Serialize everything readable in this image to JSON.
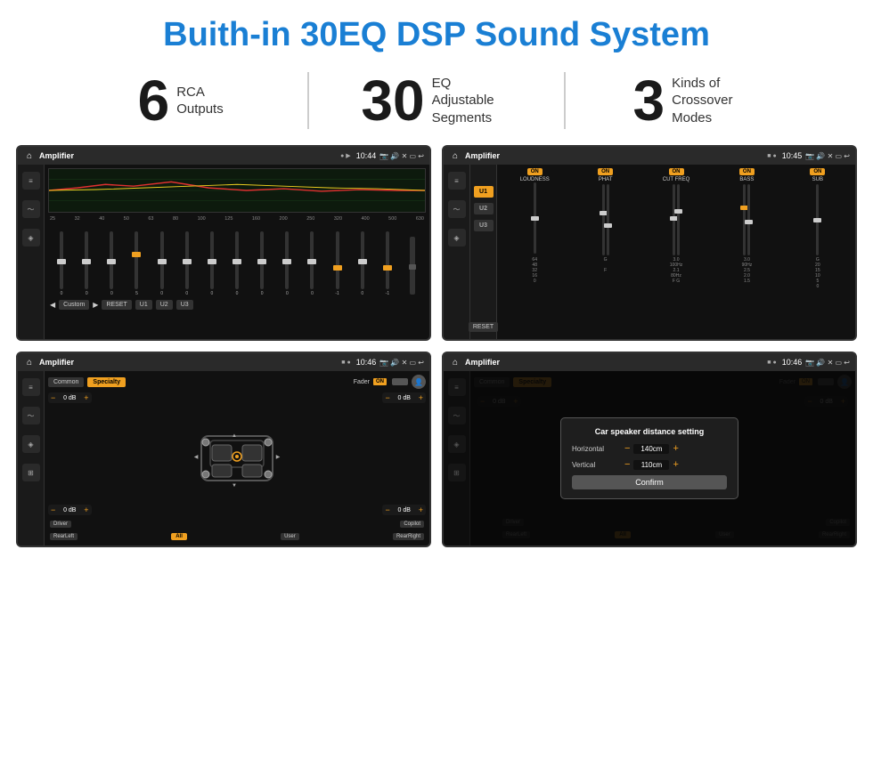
{
  "header": {
    "title": "Buith-in 30EQ DSP Sound System"
  },
  "stats": [
    {
      "number": "6",
      "label_line1": "RCA",
      "label_line2": "Outputs"
    },
    {
      "number": "30",
      "label_line1": "EQ Adjustable",
      "label_line2": "Segments"
    },
    {
      "number": "3",
      "label_line1": "Kinds of",
      "label_line2": "Crossover Modes"
    }
  ],
  "screens": [
    {
      "id": "screen1",
      "status_bar": {
        "title": "Amplifier",
        "time": "10:44"
      },
      "eq": {
        "freq_labels": [
          "25",
          "32",
          "40",
          "50",
          "63",
          "80",
          "100",
          "125",
          "160",
          "200",
          "250",
          "320",
          "400",
          "500",
          "630"
        ],
        "slider_values": [
          "0",
          "0",
          "0",
          "5",
          "0",
          "0",
          "0",
          "0",
          "0",
          "0",
          "0",
          "-1",
          "0",
          "-1",
          ""
        ],
        "presets": [
          "Custom",
          "RESET",
          "U1",
          "U2",
          "U3"
        ]
      }
    },
    {
      "id": "screen2",
      "status_bar": {
        "title": "Amplifier",
        "time": "10:45"
      },
      "u_buttons": [
        "U1",
        "U2",
        "U3"
      ],
      "channels": [
        {
          "name": "LOUDNESS",
          "toggle": "ON"
        },
        {
          "name": "PHAT",
          "toggle": "ON"
        },
        {
          "name": "CUT FREQ",
          "toggle": "ON"
        },
        {
          "name": "BASS",
          "toggle": "ON"
        },
        {
          "name": "SUB",
          "toggle": "ON"
        }
      ],
      "reset_label": "RESET"
    },
    {
      "id": "screen3",
      "status_bar": {
        "title": "Amplifier",
        "time": "10:46"
      },
      "tabs": [
        "Common",
        "Specialty"
      ],
      "fader": {
        "label": "Fader",
        "state": "ON"
      },
      "vol_controls": [
        {
          "label": "0 dB"
        },
        {
          "label": "0 dB"
        },
        {
          "label": "0 dB"
        },
        {
          "label": "0 dB"
        }
      ],
      "seat_labels": [
        "Driver",
        "Copilot",
        "RearLeft",
        "All",
        "User",
        "RearRight"
      ]
    },
    {
      "id": "screen4",
      "status_bar": {
        "title": "Amplifier",
        "time": "10:46"
      },
      "tabs": [
        "Common",
        "Specialty"
      ],
      "dialog": {
        "title": "Car speaker distance setting",
        "horizontal_label": "Horizontal",
        "horizontal_value": "140cm",
        "vertical_label": "Vertical",
        "vertical_value": "110cm",
        "confirm_label": "Confirm"
      },
      "seat_labels": [
        "Driver",
        "Copilot",
        "RearLeft",
        "All",
        "User",
        "RearRight"
      ]
    }
  ]
}
